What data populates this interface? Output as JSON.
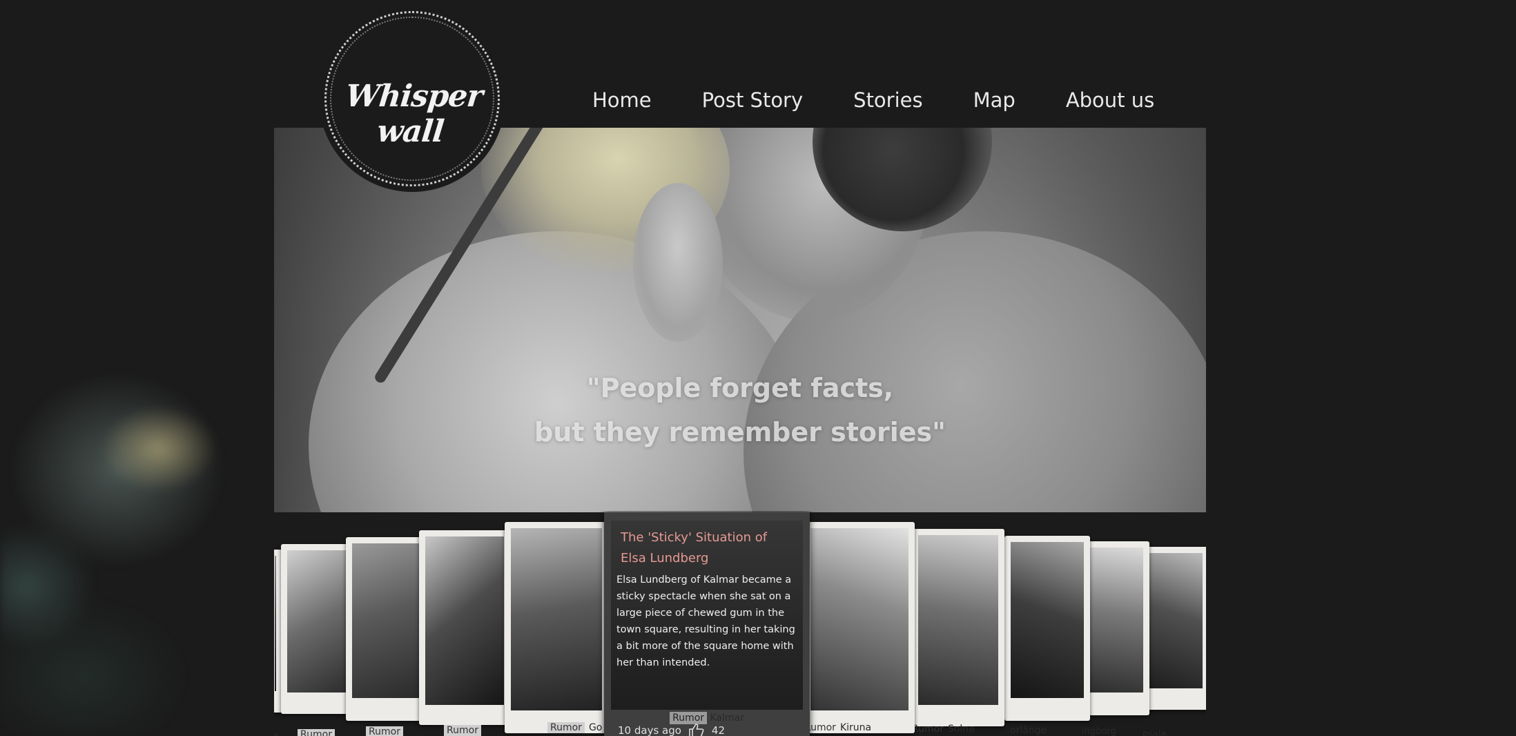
{
  "brand": {
    "logo_text": "Whisper wall"
  },
  "nav": {
    "items": [
      {
        "label": "Home"
      },
      {
        "label": "Post Story"
      },
      {
        "label": "Stories"
      },
      {
        "label": "Map"
      },
      {
        "label": "About us"
      }
    ]
  },
  "hero": {
    "quote_line1": "\"People forget facts,",
    "quote_line2": "but they remember stories\""
  },
  "carousel": {
    "left_cards": [
      {
        "tag": "",
        "place": "ne"
      },
      {
        "tag": "Rumor",
        "place": ""
      },
      {
        "tag": "Rumor",
        "place": ""
      },
      {
        "tag": "Rumor",
        "place": ""
      },
      {
        "tag": "Rumor",
        "place": "Go"
      }
    ],
    "featured": {
      "title": "The 'Sticky' Situation of Elsa Lundberg",
      "body": "Elsa Lundberg of Kalmar became a sticky spectacle when she sat on a large piece of chewed gum in the town square, resulting in her taking a bit more of the square home with her than intended.",
      "tag": "Rumor",
      "place": "Kalmar",
      "time_ago": "10 days ago",
      "likes": "42"
    },
    "right_cards": [
      {
        "tag": "Rumor",
        "place": "Kiruna"
      },
      {
        "tag": "Rumor",
        "place": "Solna"
      },
      {
        "tag": "",
        "place": "orlänge"
      },
      {
        "tag": "",
        "place": "ingborg"
      },
      {
        "tag": "",
        "place": "psala"
      }
    ]
  }
}
